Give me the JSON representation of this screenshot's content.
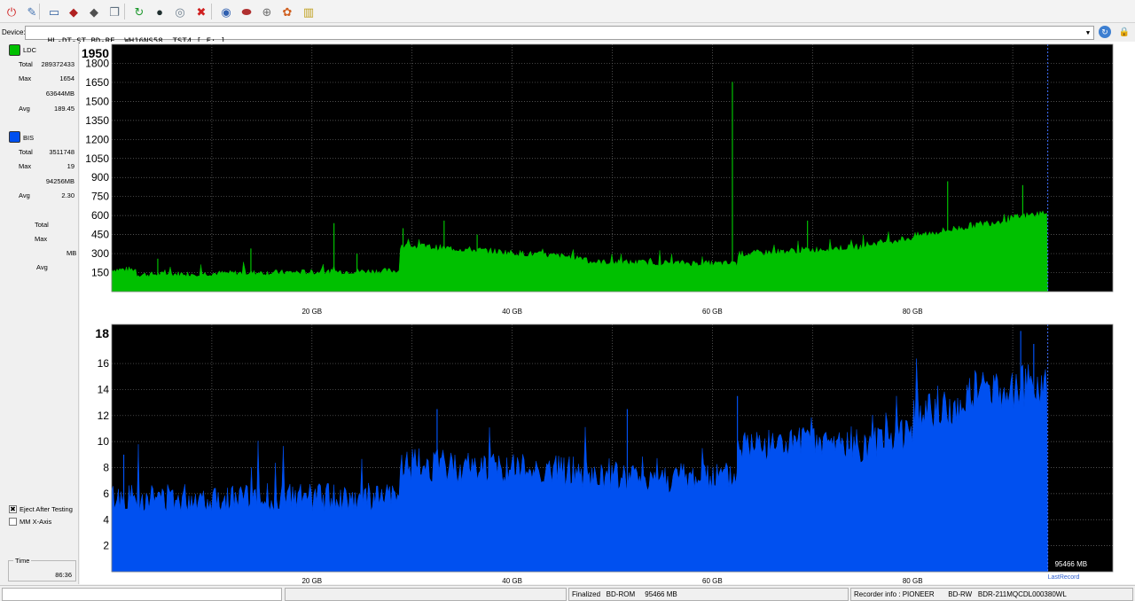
{
  "toolbar": {
    "buttons": [
      {
        "name": "power-icon",
        "glyph": "⏻",
        "color": "#d02020"
      },
      {
        "name": "wand-icon",
        "glyph": "✎",
        "color": "#4070b0"
      },
      {
        "name": "computer-icon",
        "glyph": "▭",
        "color": "#2f5f9f"
      },
      {
        "name": "disc-red-icon",
        "glyph": "◆",
        "color": "#b02020"
      },
      {
        "name": "disc-gray-icon",
        "glyph": "◆",
        "color": "#505050"
      },
      {
        "name": "copy-icon",
        "glyph": "❐",
        "color": "#607080"
      },
      {
        "name": "refresh-green-icon",
        "glyph": "↻",
        "color": "#1f9a2f"
      },
      {
        "name": "globe-icon",
        "glyph": "●",
        "color": "#1f2f2f"
      },
      {
        "name": "disc-check-icon",
        "glyph": "◎",
        "color": "#708090"
      },
      {
        "name": "stop-icon",
        "glyph": "✖",
        "color": "#d02020"
      },
      {
        "name": "disc-blue-icon",
        "glyph": "◉",
        "color": "#3060b0"
      },
      {
        "name": "eraser-icon",
        "glyph": "⬬",
        "color": "#b03030"
      },
      {
        "name": "settings-disc-icon",
        "glyph": "⊕",
        "color": "#707070"
      },
      {
        "name": "palette-icon",
        "glyph": "✿",
        "color": "#d06020"
      },
      {
        "name": "chart-icon",
        "glyph": "▥",
        "color": "#c0a020"
      }
    ]
  },
  "device": {
    "label": "Device:",
    "value": "HL-DT-ST BD-RE  WH16NS58  TST4 [ F: ]"
  },
  "ldc": {
    "label": "LDC",
    "color": "#00c000",
    "total_key": "Total",
    "total": "289372433",
    "max_key": "Max",
    "max": "1654",
    "mb": "63644MB",
    "avg_key": "Avg",
    "avg": "189.45"
  },
  "bis": {
    "label": "BIS",
    "color": "#0050f0",
    "total_key": "Total",
    "total": "3511748",
    "max_key": "Max",
    "max": "19",
    "mb": "94256MB",
    "avg_key": "Avg",
    "avg": "2.30"
  },
  "third": {
    "total_key": "Total",
    "max_key": "Max",
    "mb_key": "MB",
    "avg_key": "Avg"
  },
  "options": {
    "eject_label": "Eject After Testing",
    "eject_checked": true,
    "mm_label": "MM X-Axis",
    "mm_checked": false
  },
  "time": {
    "label": "Time",
    "value": "86:36"
  },
  "status": {
    "disc": "Finalized   BD-ROM     95466 MB",
    "recorder": "Recorder info : PIONEER       BD-RW   BDR-211MQCDL000380WL"
  },
  "chart_data": [
    {
      "type": "area",
      "series": [
        {
          "name": "LDC",
          "color": "#00c000"
        }
      ],
      "x_unit": "GB",
      "xlim": [
        0,
        100
      ],
      "ylim": [
        0,
        1950
      ],
      "x_ticks": [
        20,
        40,
        60,
        80
      ],
      "x_tick_labels": [
        "20 GB",
        "40 GB",
        "60 GB",
        "80 GB"
      ],
      "y_ticks": [
        150,
        300,
        450,
        600,
        750,
        900,
        1050,
        1200,
        1350,
        1500,
        1650,
        1800
      ],
      "y_top_label": "1950",
      "grid": true,
      "data_end": 93.5,
      "marker_x": 93.5,
      "baseline_segments": [
        {
          "x": [
            0,
            2.5
          ],
          "y": [
            170,
            170
          ]
        },
        {
          "x": [
            2.5,
            28.7
          ],
          "y": [
            130,
            160
          ]
        },
        {
          "x": [
            28.7,
            35
          ],
          "y": [
            360,
            330
          ]
        },
        {
          "x": [
            35,
            47.5
          ],
          "y": [
            330,
            260
          ]
        },
        {
          "x": [
            47.5,
            62.5
          ],
          "y": [
            230,
            215
          ]
        },
        {
          "x": [
            62.5,
            75
          ],
          "y": [
            290,
            350
          ]
        },
        {
          "x": [
            75,
            80
          ],
          "y": [
            360,
            420
          ]
        },
        {
          "x": [
            80,
            93.5
          ],
          "y": [
            430,
            620
          ]
        }
      ],
      "spikes": [
        {
          "x": 4.6,
          "y": 260
        },
        {
          "x": 13.9,
          "y": 340
        },
        {
          "x": 22.2,
          "y": 540
        },
        {
          "x": 24.5,
          "y": 300
        },
        {
          "x": 29.1,
          "y": 500
        },
        {
          "x": 33.2,
          "y": 560
        },
        {
          "x": 36.5,
          "y": 450
        },
        {
          "x": 62.0,
          "y": 1654
        },
        {
          "x": 69.5,
          "y": 560
        },
        {
          "x": 83.5,
          "y": 870
        },
        {
          "x": 91.0,
          "y": 840
        }
      ]
    },
    {
      "type": "area",
      "series": [
        {
          "name": "BIS",
          "color": "#0050f0"
        }
      ],
      "x_unit": "GB",
      "xlim": [
        0,
        100
      ],
      "ylim": [
        0,
        19
      ],
      "x_ticks": [
        20,
        40,
        60,
        80
      ],
      "x_tick_labels": [
        "20 GB",
        "40 GB",
        "60 GB",
        "80 GB"
      ],
      "y_ticks": [
        2,
        4,
        6,
        8,
        10,
        12,
        14,
        16
      ],
      "y_top_label": "18",
      "grid": true,
      "data_end": 93.5,
      "marker_x": 93.5,
      "baseline_segments": [
        {
          "x": [
            0,
            28.7
          ],
          "y": [
            5.5,
            5.5
          ]
        },
        {
          "x": [
            28.7,
            47
          ],
          "y": [
            8.0,
            7.5
          ]
        },
        {
          "x": [
            47,
            62.5
          ],
          "y": [
            7.0,
            7.0
          ]
        },
        {
          "x": [
            62.5,
            77
          ],
          "y": [
            9.5,
            9.5
          ]
        },
        {
          "x": [
            77,
            80
          ],
          "y": [
            10.5,
            10.5
          ]
        },
        {
          "x": [
            80,
            85
          ],
          "y": [
            12.0,
            12.0
          ]
        },
        {
          "x": [
            85,
            93.5
          ],
          "y": [
            13.5,
            14.0
          ]
        }
      ],
      "spikes": [
        {
          "x": 1.2,
          "y": 9
        },
        {
          "x": 32.5,
          "y": 12.5
        },
        {
          "x": 51.5,
          "y": 12.5
        },
        {
          "x": 62.5,
          "y": 13.5
        },
        {
          "x": 90.8,
          "y": 18.5
        },
        {
          "x": 92.1,
          "y": 17.5
        }
      ],
      "end_label": "95466 MB",
      "last_label": "LastRecord"
    }
  ]
}
